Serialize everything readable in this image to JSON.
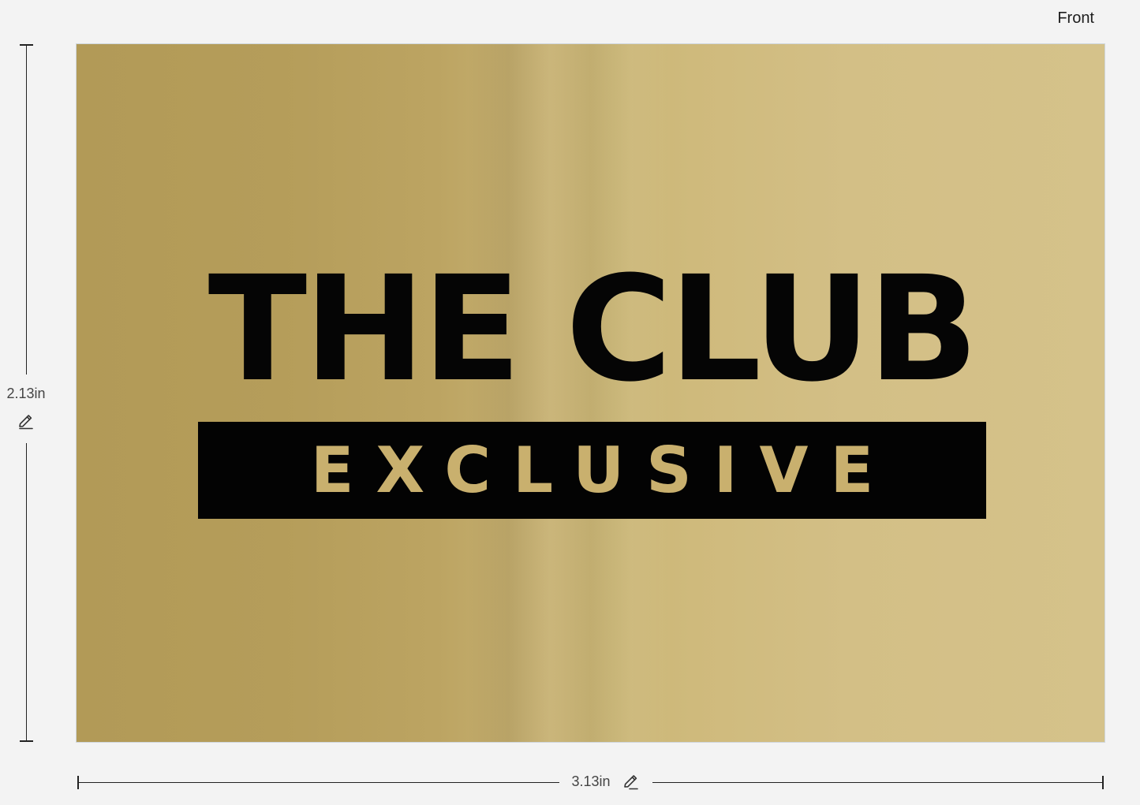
{
  "view": {
    "side_label": "Front"
  },
  "card": {
    "headline": "THE CLUB",
    "band_text": "EXCLUSIVE",
    "colors": {
      "gold": "#c8b273",
      "ink": "#050505"
    }
  },
  "dimensions": {
    "height_label": "2.13in",
    "width_label": "3.13in",
    "edit_icon": "pencil-icon"
  }
}
